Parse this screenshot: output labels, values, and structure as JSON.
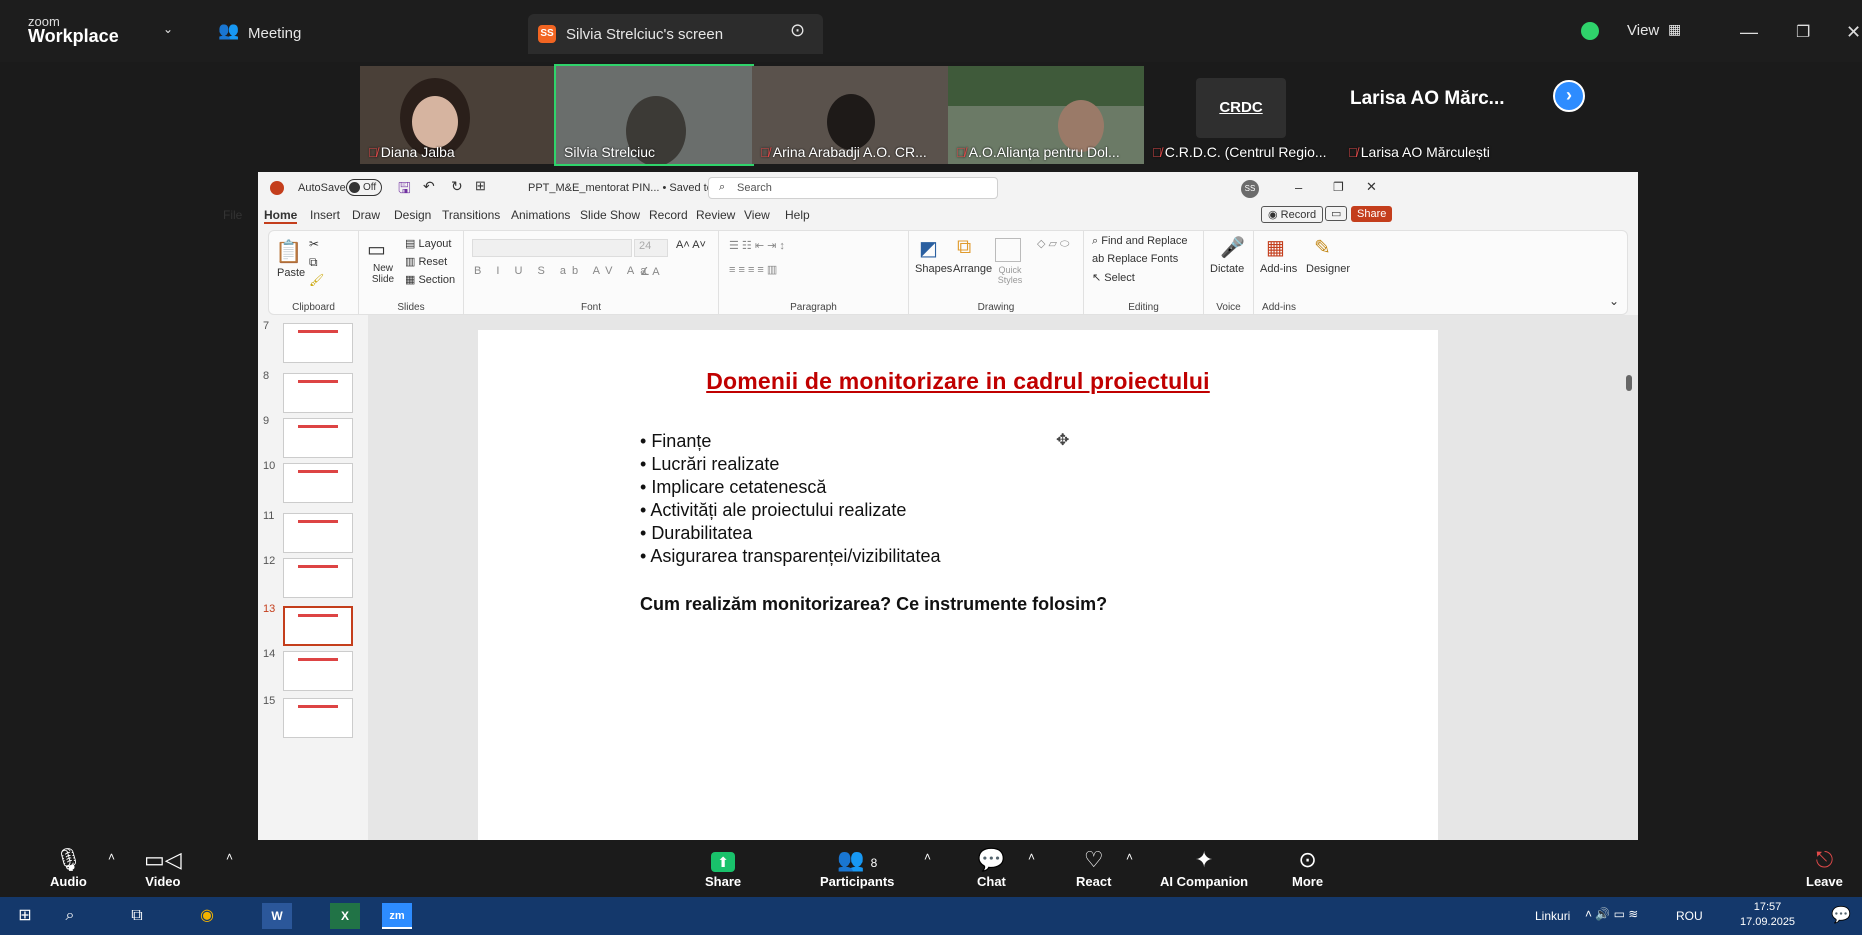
{
  "zoom": {
    "brand_small": "zoom",
    "brand_large": "Workplace",
    "meeting_label": "Meeting",
    "share_badge": "SS",
    "share_title": "Silvia Strelciuc's screen",
    "view_label": "View",
    "participants_tiles": [
      {
        "name": "Diana Jalba",
        "muted": true
      },
      {
        "name": "Silvia Strelciuc",
        "muted": false
      },
      {
        "name": "Arina Arabadji A.O. CR...",
        "muted": true
      },
      {
        "name": "A.O.Alianța pentru Dol...",
        "muted": true
      },
      {
        "name": "C.R.D.C. (Centrul Regio...",
        "muted": true,
        "logo": "CRDC"
      },
      {
        "name": "Larisa AO Mărculești",
        "muted": true,
        "big_name": "Larisa AO Mărc..."
      }
    ],
    "toolbar": {
      "audio": "Audio",
      "video": "Video",
      "share": "Share",
      "participants": "Participants",
      "participants_count": "8",
      "chat": "Chat",
      "react": "React",
      "ai": "AI Companion",
      "more": "More",
      "leave": "Leave"
    }
  },
  "ppt": {
    "autosave": "AutoSave",
    "autosave_state": "Off",
    "filename": "PPT_M&E_mentorat PIN... • Saved to this PC",
    "search_placeholder": "Search",
    "user_initials": "SS",
    "tabs": [
      "File",
      "Home",
      "Insert",
      "Draw",
      "Design",
      "Transitions",
      "Animations",
      "Slide Show",
      "Record",
      "Review",
      "View",
      "Help"
    ],
    "active_tab": "Home",
    "record_btn": "Record",
    "share_btn": "Share",
    "ribbon": {
      "clipboard": {
        "label": "Clipboard",
        "paste": "Paste"
      },
      "slides": {
        "label": "Slides",
        "new_slide": "New Slide",
        "layout": "Layout",
        "reset": "Reset",
        "section": "Section"
      },
      "font": {
        "label": "Font",
        "size": "24"
      },
      "paragraph": {
        "label": "Paragraph"
      },
      "drawing": {
        "label": "Drawing",
        "shapes": "Shapes",
        "arrange": "Arrange",
        "quick_styles": "Quick Styles"
      },
      "editing": {
        "label": "Editing",
        "find": "Find and Replace",
        "replace_fonts": "Replace Fonts",
        "select": "Select"
      },
      "voice": {
        "label": "Voice",
        "dictate": "Dictate"
      },
      "addins": {
        "label": "Add-ins",
        "addins": "Add-ins",
        "designer": "Designer"
      }
    },
    "slide_numbers": [
      "7",
      "8",
      "9",
      "10",
      "11",
      "12",
      "13",
      "14",
      "15"
    ],
    "selected_slide": "13",
    "slide": {
      "title": "Domenii de monitorizare in cadrul proiectului",
      "bullets": [
        "Finanțe",
        "Lucrări realizate",
        "Implicare cetatenescă",
        "Activități ale proiectului realizate",
        "Durabilitatea",
        "Asigurarea transparenței/vizibilitatea"
      ],
      "question": "Cum realizăm monitorizarea? Ce instrumente folosim?"
    }
  },
  "taskbar": {
    "linkuri": "Linkuri",
    "lang": "ROU",
    "time": "17:57",
    "date": "17.09.2025"
  },
  "colors": {
    "accent_red": "#c00000",
    "zoom_green": "#2fd36b",
    "taskbar": "#14386b"
  }
}
